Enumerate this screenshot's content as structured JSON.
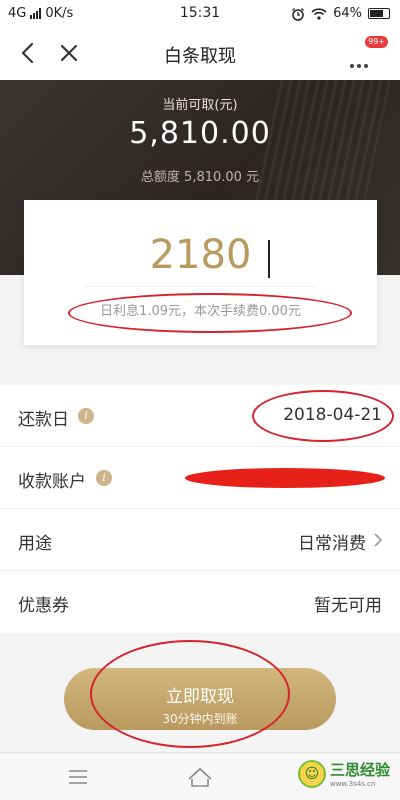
{
  "status_bar": {
    "network": "4G",
    "speed": "0K/s",
    "time": "15:31",
    "battery": "64%",
    "icons": [
      "alarm-icon",
      "wifi-icon",
      "battery-icon"
    ]
  },
  "nav": {
    "title": "白条取现",
    "badge": "99+",
    "icons": [
      "back-arrow-icon",
      "close-icon",
      "more-icon"
    ]
  },
  "hero": {
    "available_label": "当前可取(元)",
    "available_amount": "5,810.00",
    "total_label": "总额度 5,810.00 元"
  },
  "withdraw": {
    "amount": "2180",
    "fee_text": "日利息1.09元，本次手续费0.00元"
  },
  "rows": [
    {
      "label": "还款日",
      "value": "2018-04-21",
      "has_info": true
    },
    {
      "label": "收款账户",
      "value": "",
      "has_info": true,
      "redacted": true
    },
    {
      "label": "用途",
      "value": "日常消费",
      "has_chevron": true
    },
    {
      "label": "优惠券",
      "value": "暂无可用"
    }
  ],
  "cta": {
    "label": "立即取现",
    "sub_label": "30分钟内到账"
  },
  "watermark": {
    "text": "三思经验",
    "url": "www.3s4s.cn"
  },
  "colors": {
    "gold": "#b99a5e",
    "annotation_red": "#d6232e",
    "hero_bg": "#2b2624"
  }
}
